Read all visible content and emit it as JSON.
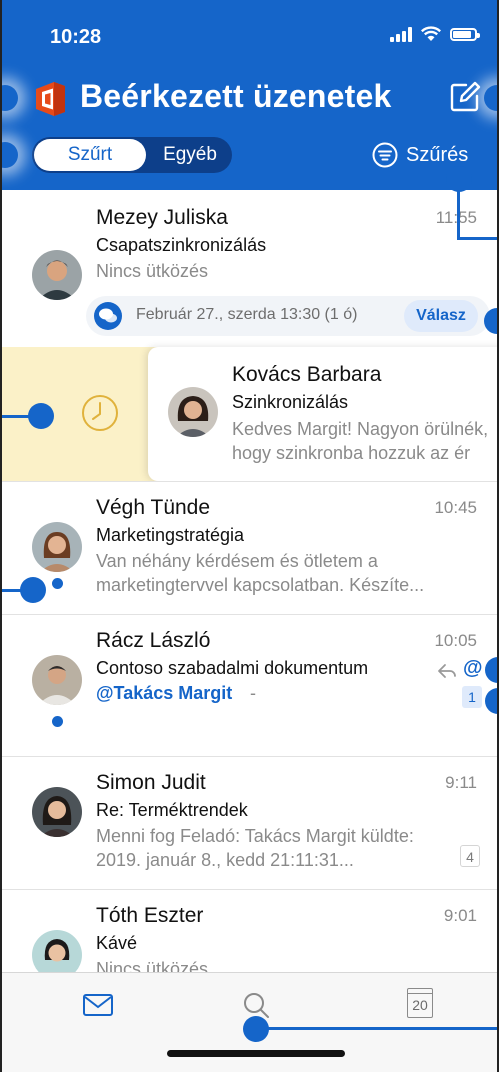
{
  "status": {
    "time": "10:28"
  },
  "header": {
    "title": "Beérkezett üzenetek",
    "filter_tabs": {
      "focused": "Szűrt",
      "other": "Egyéb"
    },
    "filter_label": "Szűrés"
  },
  "messages": [
    {
      "sender": "Mezey Juliska",
      "subject": "Csapatszinkronizálás",
      "preview": "Nincs ütközés",
      "time": "11:55",
      "event": {
        "text": "Február 27., szerda 13:30 (1 ó)",
        "reply_label": "Válasz"
      }
    },
    {
      "sender": "Kovács Barbara",
      "subject": "Szinkronizálás",
      "preview_line1": "Kedves Margit! Nagyon örülnék,",
      "preview_line2": "hogy szinkronba hozzuk az ér"
    },
    {
      "sender": "Végh Tünde",
      "subject": "Marketingstratégia",
      "preview_line1": "Van néhány kérdésem és ötletem a",
      "preview_line2": "marketingtervvel kapcsolatban. Készíte...",
      "time": "10:45"
    },
    {
      "sender": "Rácz László",
      "subject": "Contoso szabadalmi dokumentum",
      "mention": "@Takács Margit",
      "mention_suffix": "-",
      "time": "10:05",
      "count": "1"
    },
    {
      "sender": "Simon Judit",
      "subject": "Re: Terméktrendek",
      "preview_line1": "Menni fog Feladó: Takács Margit küldte:",
      "preview_line2": "2019. január 8., kedd 21:11:31...",
      "time": "9:11",
      "count": "4"
    },
    {
      "sender": "Tóth Eszter",
      "subject": "Kávé",
      "preview": "Nincs ütközés",
      "time": "9:01"
    }
  ],
  "tabbar": {
    "calendar_day": "20"
  },
  "colors": {
    "accent": "#1565c9",
    "swipe_bg": "#fbf1c8",
    "header_bg": "#1565c9"
  },
  "icons": [
    "office-logo-icon",
    "compose-icon",
    "filter-icon",
    "chat-icon",
    "clock-icon",
    "reply-icon",
    "at-icon",
    "mail-icon",
    "search-icon",
    "calendar-icon"
  ]
}
